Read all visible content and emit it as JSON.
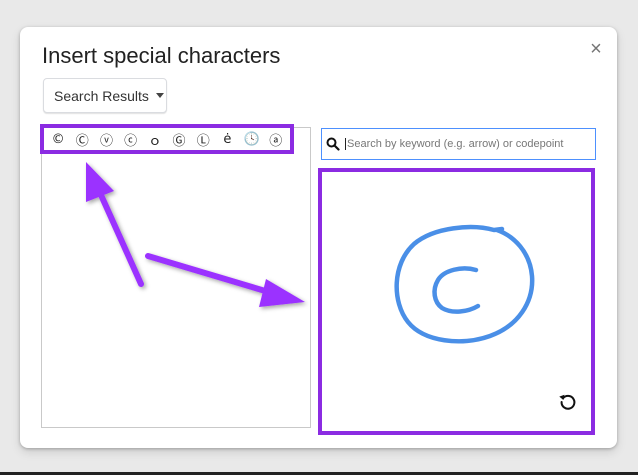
{
  "dialog": {
    "title": "Insert special characters",
    "close_symbol": "×"
  },
  "category_dropdown": {
    "selected": "Search Results"
  },
  "results": {
    "symbols": [
      "©",
      "Ⓒ",
      "ⓥ",
      "ⓒ",
      "ｏ",
      "Ⓖ",
      "Ⓛ",
      "ė",
      "🕓",
      "ⓐ"
    ]
  },
  "search": {
    "placeholder": "Search by keyword (e.g. arrow) or codepoint"
  },
  "colors": {
    "highlight": "#8b2be2",
    "ink_stroke": "#4a8fe7",
    "search_border": "#4d90fe"
  },
  "icons": {
    "search": "search-icon",
    "close": "close-icon",
    "reset": "reset-icon",
    "dropdown": "chevron-down-icon"
  }
}
